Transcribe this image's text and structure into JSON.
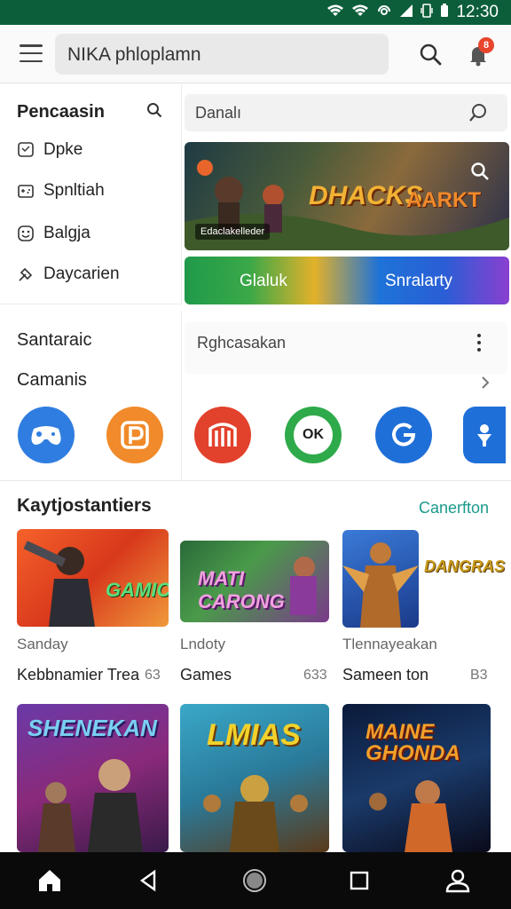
{
  "status": {
    "time": "12:30"
  },
  "header": {
    "search_text": "NIKA phloplamn",
    "notification_count": "8"
  },
  "sidebar": {
    "title": "Pencaasin",
    "items": [
      {
        "label": "Dpke",
        "icon": "chat-icon"
      },
      {
        "label": "Spnltiah",
        "icon": "gamepad-icon"
      },
      {
        "label": "Balgja",
        "icon": "smile-icon"
      },
      {
        "label": "Daycarien",
        "icon": "tag-icon"
      }
    ]
  },
  "right_search": {
    "text": "Danalı"
  },
  "banner": {
    "title": "DHACKS",
    "title2": "AARKT",
    "caption": "Edaclakelleder"
  },
  "split_banner": {
    "left": "Glaluk",
    "right": "Snralarty"
  },
  "section2": {
    "title1": "Santaraic",
    "title2": "Camanis",
    "right_label": "Rghcasakan",
    "apps": [
      {
        "glyph": "",
        "color": "#2f7de0",
        "icon": "controller-icon"
      },
      {
        "glyph": "P",
        "color": "#f08a2a",
        "icon": "p-logo-icon"
      },
      {
        "glyph": "m",
        "color": "#e2412c",
        "icon": "m-logo-icon"
      },
      {
        "glyph": "OK",
        "color": "#2faa4a",
        "icon": "ok-logo-icon"
      },
      {
        "glyph": "G",
        "color": "#1f6fd8",
        "icon": "g-logo-icon"
      },
      {
        "glyph": "",
        "color": "#1f6fd8",
        "icon": "person-logo-icon"
      }
    ]
  },
  "section3": {
    "title": "Kaytjostantiers",
    "link": "Canerfton",
    "cards": [
      {
        "caption": "GAMIC",
        "sub": "Sanday",
        "title": "Kebbnamier Trea",
        "count": "63"
      },
      {
        "caption": "MATI CARONG",
        "sub": "Lndoty",
        "title": "Games",
        "count": "633"
      },
      {
        "caption": "DANGRAS",
        "sub": "Tlennayeakan",
        "title": "Sameen ton",
        "count": "B3"
      }
    ],
    "row2": [
      {
        "caption": "SHENEKAN"
      },
      {
        "caption": "LMIAS"
      },
      {
        "caption": "MAINE GHONDA"
      }
    ]
  }
}
